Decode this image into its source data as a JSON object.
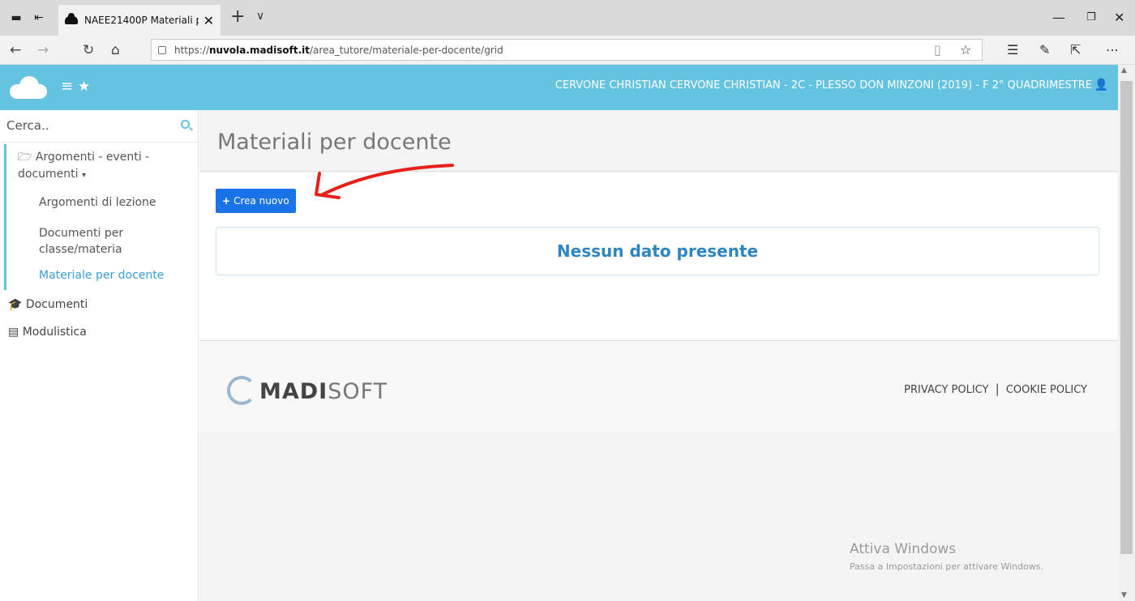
{
  "browser": {
    "tab_title": "NAEE21400P Materiali p",
    "url_prefix": "https://",
    "url_domain": "nuvola.madisoft.it",
    "url_path": "/area_tutore/materiale-per-docente/grid",
    "icons": [
      "tab-manage-icon",
      "tab-back-icon",
      "cloud-icon",
      "close-icon",
      "plus-icon",
      "chevron-down-icon",
      "minimize-icon",
      "restore-icon",
      "back-icon",
      "forward-icon",
      "refresh-icon",
      "home-icon",
      "lock-icon",
      "reading-view-icon",
      "favorite-icon",
      "favorites-list-icon",
      "pen-icon",
      "share-icon",
      "more-icon"
    ]
  },
  "topnav": {
    "user_info": "CERVONE CHRISTIAN  CERVONE CHRISTIAN - 2C - PLESSO DON MINZONI (2019) - F  2° QUADRIMESTRE",
    "accent_color": "#64c3e0"
  },
  "sidebar": {
    "search_placeholder": "Cerca..",
    "group_title": "Argomenti - eventi - documenti",
    "group_caret": "▾",
    "items": [
      {
        "label": "Argomenti di lezione"
      },
      {
        "label": "Documenti per classe/materia"
      },
      {
        "label": "Materiale per docente"
      }
    ],
    "sections": [
      {
        "label": "Documenti",
        "icon": "graduation-cap-icon"
      },
      {
        "label": "Modulistica",
        "icon": "forms-icon"
      }
    ]
  },
  "main": {
    "title": "Materiali per docente",
    "new_button": "Crea nuovo",
    "empty_message": "Nessun dato presente"
  },
  "footer": {
    "logo_bold": "MADI",
    "logo_light": "SOFT",
    "privacy": "PRIVACY POLICY",
    "separator": "|",
    "cookie": "COOKIE POLICY"
  },
  "watermark": {
    "line1": "Attiva Windows",
    "line2": "Passa a Impostazioni per attivare Windows."
  }
}
